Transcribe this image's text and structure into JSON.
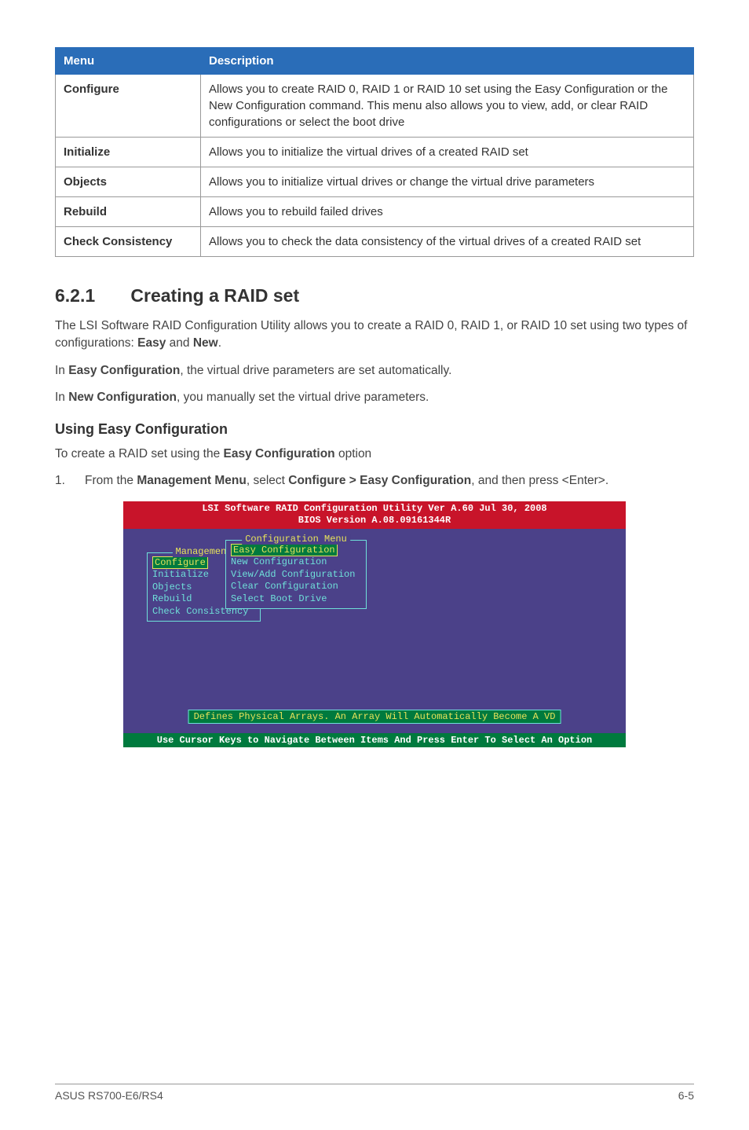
{
  "table": {
    "headers": [
      "Menu",
      "Description"
    ],
    "rows": [
      {
        "menu": "Configure",
        "desc": "Allows you to create RAID 0, RAID 1 or RAID 10 set using the Easy Configuration or the New Configuration command. This menu also allows you to view, add, or clear RAID configurations or select the boot drive"
      },
      {
        "menu": "Initialize",
        "desc": "Allows you to initialize the virtual drives of a created RAID set"
      },
      {
        "menu": "Objects",
        "desc": "Allows you to initialize virtual drives or change the virtual drive parameters"
      },
      {
        "menu": "Rebuild",
        "desc": "Allows you to rebuild failed drives"
      },
      {
        "menu": "Check Consistency",
        "desc": "Allows you to check the data consistency of the virtual drives of a created RAID set"
      }
    ]
  },
  "section": {
    "number": "6.2.1",
    "title": "Creating a RAID set",
    "para1_a": "The LSI Software RAID Configuration Utility allows you to create a RAID 0, RAID 1, or RAID 10 set using two types of configurations: ",
    "para1_b": "Easy",
    "para1_c": " and ",
    "para1_d": "New",
    "para1_e": ".",
    "para2_a": "In ",
    "para2_b": "Easy Configuration",
    "para2_c": ", the virtual drive parameters are set automatically.",
    "para3_a": "In ",
    "para3_b": "New Configuration",
    "para3_c": ", you manually set the virtual drive parameters.",
    "subheading": "Using Easy Configuration",
    "para4_a": "To create a RAID set using the ",
    "para4_b": "Easy Configuration",
    "para4_c": " option",
    "step1_n": "1.",
    "step1_a": "From the ",
    "step1_b": "Management Menu",
    "step1_c": ", select ",
    "step1_d": "Configure > Easy Configuration",
    "step1_e": ", and then press <Enter>."
  },
  "bios": {
    "header_line1": "LSI Software RAID Configuration Utility Ver A.60 Jul 30, 2008",
    "header_line2": "BIOS Version  A.08.09161344R",
    "mgmt_title": "Management",
    "mgmt_items": [
      "Configure",
      "Initialize",
      "Objects",
      "Rebuild",
      "Check Consistency"
    ],
    "conf_title": "Configuration Menu",
    "conf_items": [
      "Easy Configuration",
      "New Configuration",
      "View/Add Configuration",
      "Clear Configuration",
      "Select Boot Drive"
    ],
    "status": "Defines Physical Arrays. An Array Will Automatically Become A VD",
    "footer": "Use Cursor Keys to Navigate Between Items And Press Enter To Select An Option"
  },
  "page_footer": {
    "left": "ASUS RS700-E6/RS4",
    "right": "6-5"
  }
}
